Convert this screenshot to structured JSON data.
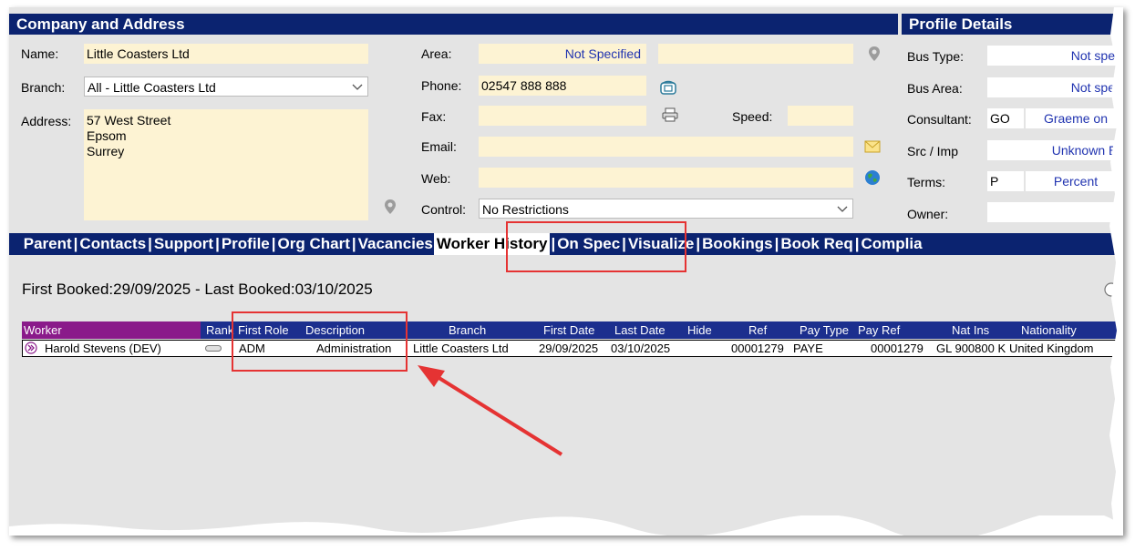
{
  "company": {
    "header": "Company and Address",
    "name_label": "Name:",
    "name_value": "Little Coasters Ltd",
    "branch_label": "Branch:",
    "branch_value": "All - Little Coasters Ltd",
    "address_label": "Address:",
    "address_line1": "57 West Street",
    "address_line2": "Epsom",
    "address_line3": "Surrey",
    "area_label": "Area:",
    "area_value": "Not Specified",
    "phone_label": "Phone:",
    "phone_value": "02547 888 888",
    "fax_label": "Fax:",
    "speed_label": "Speed:",
    "email_label": "Email:",
    "web_label": "Web:",
    "control_label": "Control:",
    "control_value": "No Restrictions"
  },
  "profile": {
    "header": "Profile Details",
    "bus_type_label": "Bus Type:",
    "bus_type_value": "Not spec",
    "bus_area_label": "Bus Area:",
    "bus_area_value": "Not spec",
    "consultant_label": "Consultant:",
    "consultant_code": "GO",
    "consultant_name": "Graeme on",
    "src_label": "Src / Imp",
    "src_value": "Unknown Er",
    "terms_label": "Terms:",
    "terms_code": "P",
    "terms_value": "Percent",
    "owner_label": "Owner:"
  },
  "tabs": [
    "Parent",
    "Contacts",
    "Support",
    "Profile",
    "Org Chart",
    "Vacancies",
    "Worker History",
    "On Spec",
    "Visualize",
    "Bookings",
    "Book Req",
    "Complia"
  ],
  "active_tab": "Worker History",
  "history": {
    "summary": "First Booked:29/09/2025 - Last Booked:03/10/2025",
    "columns": {
      "worker": "Worker",
      "rank": "Rank",
      "first_role": "First Role",
      "description": "Description",
      "branch": "Branch",
      "first_date": "First Date",
      "last_date": "Last Date",
      "hide": "Hide",
      "ref": "Ref",
      "pay_type": "Pay Type",
      "pay_ref": "Pay Ref",
      "nat_ins": "Nat Ins",
      "nationality": "Nationality"
    },
    "row": {
      "worker": "Harold Stevens (DEV)",
      "first_role": "ADM",
      "description": "Administration",
      "branch": "Little Coasters Ltd",
      "first_date": "29/09/2025",
      "last_date": "03/10/2025",
      "ref": "00001279",
      "pay_type": "PAYE",
      "pay_ref": "00001279",
      "nat_ins": "GL 900800 K",
      "nationality": "United Kingdom"
    }
  },
  "colors": {
    "header_bg": "#0b2370",
    "grid_header_bg": "#1c2f8e",
    "worker_col_bg": "#8a1a8a",
    "field_bg": "#fdf3d3",
    "annotation_red": "#e53333"
  }
}
